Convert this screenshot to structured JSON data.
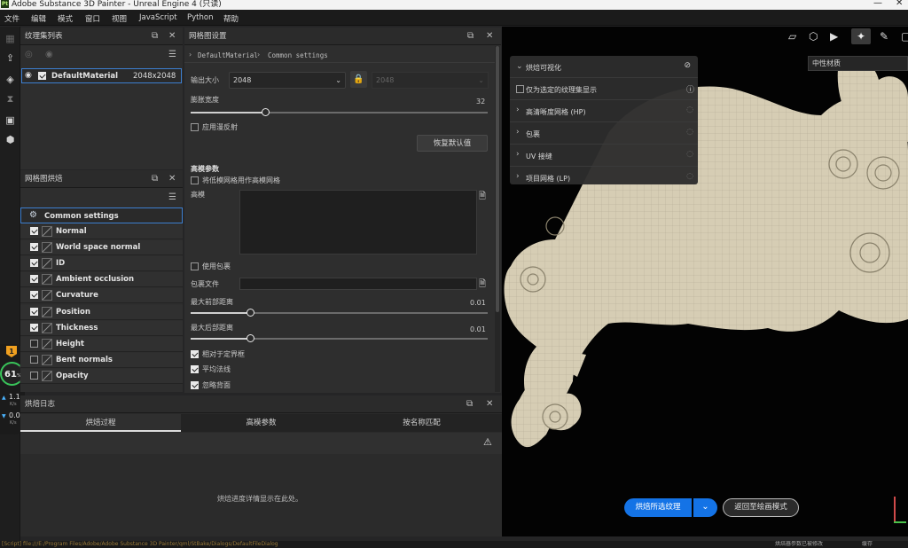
{
  "window": {
    "title": "Adobe Substance 3D Painter - Unreal Engine 4 (只读)",
    "logo": "Pt"
  },
  "menu": [
    "文件",
    "编辑",
    "模式",
    "窗口",
    "视图",
    "JavaScript",
    "Python",
    "帮助"
  ],
  "texture_set_panel": {
    "title": "纹理集列表",
    "material_name": "DefaultMaterial",
    "resolution": "2048x2048"
  },
  "baker_panel": {
    "title": "网格图烘焙",
    "common": "Common settings",
    "items": [
      {
        "label": "Normal",
        "checked": true
      },
      {
        "label": "World space normal",
        "checked": true
      },
      {
        "label": "ID",
        "checked": true
      },
      {
        "label": "Ambient occlusion",
        "checked": true
      },
      {
        "label": "Curvature",
        "checked": true
      },
      {
        "label": "Position",
        "checked": true
      },
      {
        "label": "Thickness",
        "checked": true
      },
      {
        "label": "Height",
        "checked": false
      },
      {
        "label": "Bent normals",
        "checked": false
      },
      {
        "label": "Opacity",
        "checked": false
      }
    ]
  },
  "settings_panel": {
    "title": "网格图设置",
    "breadcrumb_material": "DefaultMaterial",
    "breadcrumb_section": "Common settings",
    "output_size_label": "输出大小",
    "output_size_value": "2048",
    "output_size_locked_value": "2048",
    "dilation_label": "膨胀宽度",
    "dilation_value": "32",
    "dilation_fraction": 0.25,
    "apply_diffusion_label": "应用漫反射",
    "reset_button": "恢复默认值",
    "highpoly_section": "高模参数",
    "use_lowpoly_label": "将低模网格用作高模网格",
    "highpoly_label": "高模",
    "use_cage_label": "使用包裹",
    "cage_file_label": "包裹文件",
    "max_front_label": "最大前部距离",
    "max_front_value": "0.01",
    "max_front_fraction": 0.2,
    "max_rear_label": "最大后部距离",
    "max_rear_value": "0.01",
    "max_rear_fraction": 0.2,
    "relative_bbox_label": "相对于定界框",
    "average_normals_label": "平均法线",
    "ignore_backface_label": "忽略背面"
  },
  "bake_log": {
    "title": "烘焙日志",
    "tabs": [
      "烘焙过程",
      "高模参数",
      "按名称匹配"
    ],
    "empty_message": "烘焙进度详情显示在此处。"
  },
  "viewport": {
    "material_dropdown": "中性材质",
    "vis_title": "烘焙可视化",
    "vis_only_selected": "仅为选定的纹理集显示",
    "vis_items": [
      "高清晰度网格 (HP)",
      "包裹",
      "UV 接缝",
      "项目网格 (LP)"
    ],
    "bake_button": "烘焙所选纹理",
    "return_button": "返回至绘画模式"
  },
  "perf_widget": {
    "percent": "61",
    "percent_unit": "%",
    "up_value": "1.1",
    "up_unit": "K/s",
    "down_value": "0.0",
    "down_unit": "K/s"
  },
  "statusbar": {
    "text": "[Script] file:///E:/Program Files/Adobe/Adobe Substance 3D Painter/qml/StBake/Dialogs/DefaultFileDialog",
    "right_a": "烘焙器参数已被修改",
    "right_b": "缓存"
  },
  "colors": {
    "accent": "#1473e6",
    "panel": "#2e2e2e",
    "viewport": "#030303",
    "model": "#d6cdb4"
  }
}
